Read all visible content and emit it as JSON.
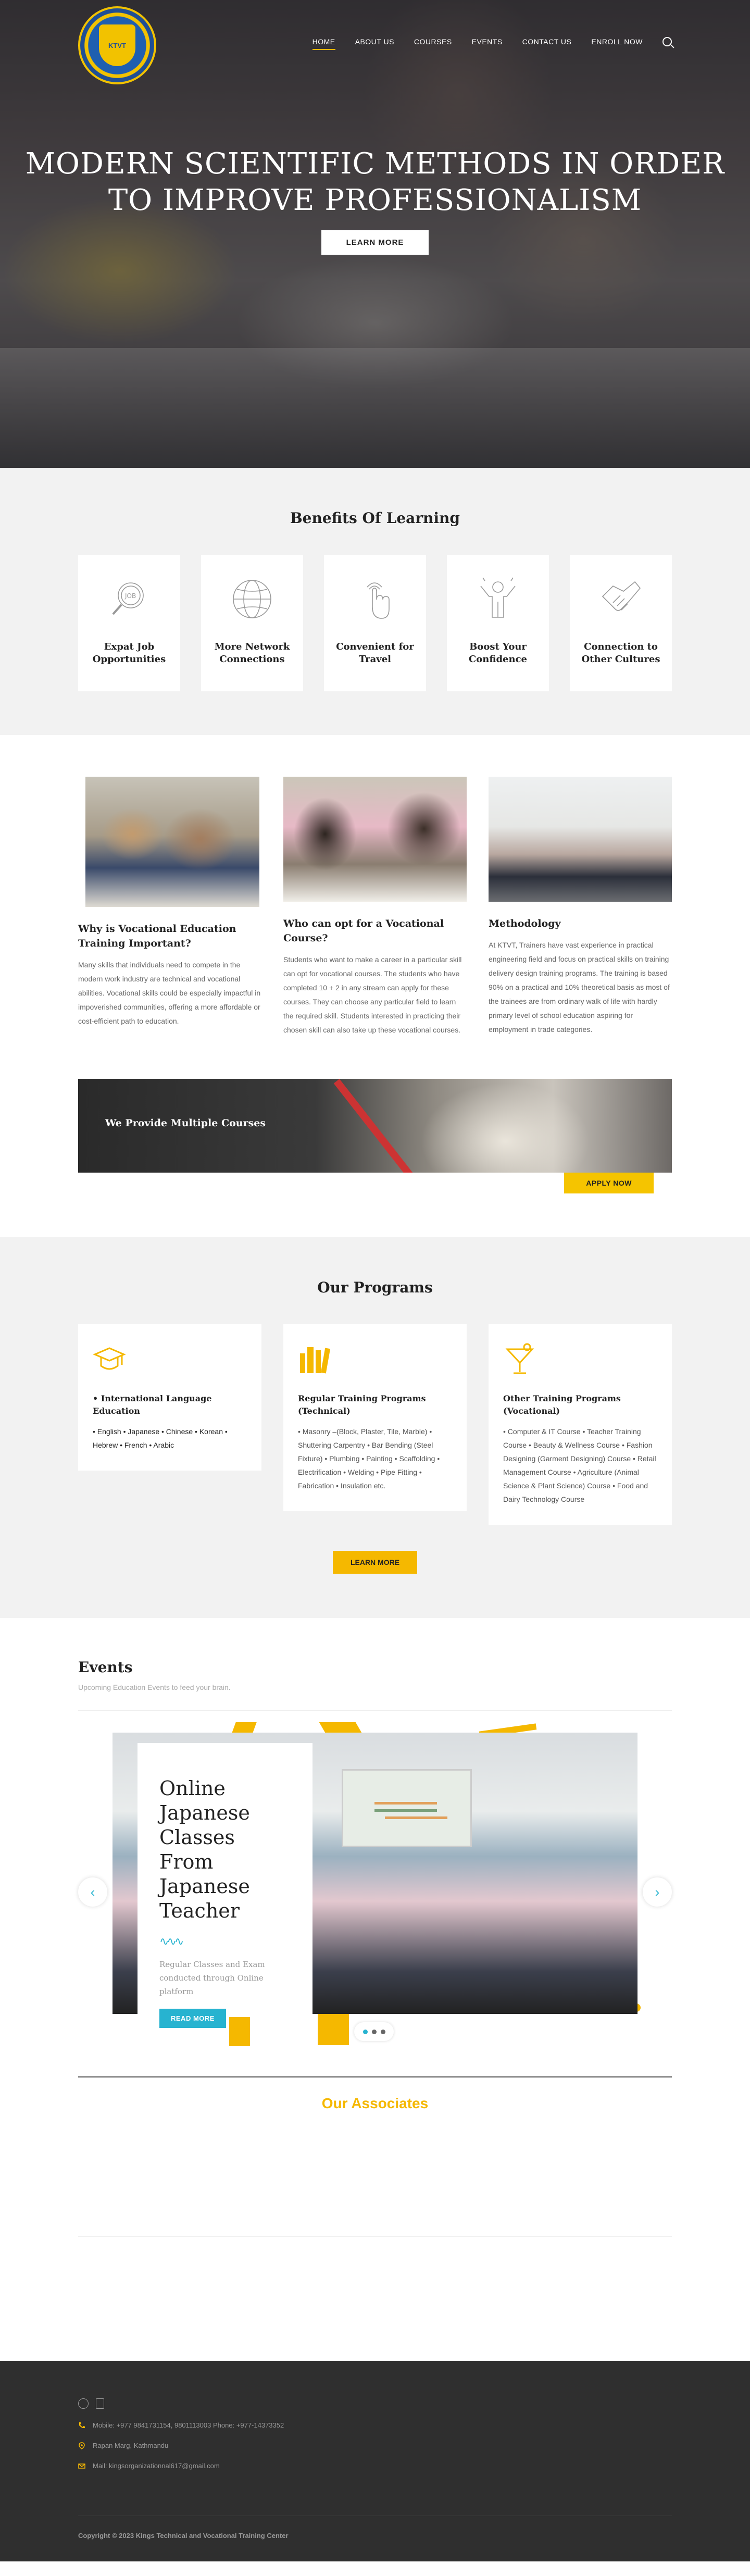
{
  "nav": {
    "logo_text": "KTVT",
    "items": [
      "HOME",
      "ABOUT US",
      "COURSES",
      "EVENTS",
      "CONTACT US",
      "ENROLL NOW"
    ]
  },
  "hero": {
    "title_line1": "MODERN SCIENTIFIC METHODS IN ORDER",
    "title_line2": "TO IMPROVE PROFESSIONALISM",
    "button": "LEARN MORE"
  },
  "benefits": {
    "title": "Benefits Of Learning",
    "items": [
      {
        "line1": "Expat Job",
        "line2": "Opportunities",
        "icon": "job-search-icon"
      },
      {
        "line1": "More Network",
        "line2": "Connections",
        "icon": "globe-network-icon"
      },
      {
        "line1": "Convenient for",
        "line2": "Travel",
        "icon": "touch-hand-icon"
      },
      {
        "line1": "Boost Your",
        "line2": "Confidence",
        "icon": "confidence-person-icon"
      },
      {
        "line1": "Connection to",
        "line2": "Other Cultures",
        "icon": "handshake-icon"
      }
    ]
  },
  "info": [
    {
      "title": "Why is Vocational Education Training Important?",
      "text": "Many skills that individuals need to compete in the modern work industry are technical and vocational abilities. Vocational skills could be especially impactful in impoverished communities, offering a more affordable or cost-efficient path to education."
    },
    {
      "title": "Who can opt for a Vocational Course?",
      "text": "Students who want to make a career in a particular skill can opt for vocational courses. The students who have completed 10 + 2 in any stream can apply for these courses. They can choose any particular field to learn the required skill. Students interested in practicing their chosen skill can also take up these vocational courses."
    },
    {
      "title": "Methodology",
      "text": "At KTVT, Trainers have vast experience in practical engineering field and focus on practical skills on training delivery design training programs. The training is based 90% on a practical and 10% theoretical basis as most of the trainees are from ordinary walk of life with hardly primary level of school education aspiring for employment in trade categories."
    }
  ],
  "banner": {
    "label": "We Provide Multiple Courses",
    "button": "APPLY NOW"
  },
  "programs": {
    "title": "Our Programs",
    "cards": [
      {
        "title": "• International Language Education",
        "text": "• English • Japanese • Chinese • Korean • Hebrew • French • Arabic",
        "icon": "graduation-cap-icon"
      },
      {
        "title": "Regular Training Programs (Technical)",
        "text": "• Masonry –(Block, Plaster, Tile, Marble) • Shuttering Carpentry • Bar Bending (Steel Fixture) • Plumbing • Painting • Scaffolding • Electrification • Welding • Pipe Fitting • Fabrication • Insulation etc.",
        "icon": "books-icon"
      },
      {
        "title": "Other Training Programs (Vocational)",
        "text": "• Computer & IT Course • Teacher Training Course • Beauty & Wellness Course • Fashion Designing (Garment Designing) Course • Retail Management Course • Agriculture (Animal Science & Plant Science) Course • Food and Dairy Technology Course",
        "icon": "cocktail-glass-icon"
      }
    ],
    "button": "LEARN MORE"
  },
  "events": {
    "title": "Events",
    "subtitle": "Upcoming Education Events to feed your brain.",
    "slide": {
      "title": "Online Japanese Classes From Japanese Teacher",
      "wave": "∿∿∿",
      "text": "Regular Classes and Exam conducted through Online platform",
      "button": "READ MORE"
    },
    "prev": "‹",
    "next": "›"
  },
  "associates": {
    "title": "Our Associates"
  },
  "footer": {
    "mobile": "Mobile: +977 9841731154, 9801113003 Phone: +977-14373352",
    "address": "Rapan Marg, Kathmandu",
    "mail": "Mail: kingsorganizationnal617@gmail.com",
    "copyright": "Copyright © 2023 Kings Technical and Vocational Training Center"
  },
  "colors": {
    "accent": "#f5b800",
    "teal": "#27b3d0",
    "footer_bg": "#2f2f2f"
  }
}
